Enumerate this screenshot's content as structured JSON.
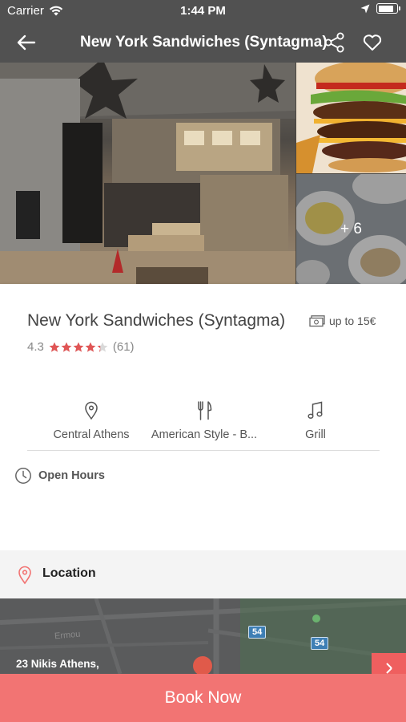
{
  "status_bar": {
    "carrier": "Carrier",
    "time": "1:44 PM",
    "battery_level": 0.9
  },
  "nav": {
    "title": "New York Sandwiches (Syntagma)",
    "icons": [
      "back-arrow-icon",
      "share-icon",
      "heart-icon"
    ]
  },
  "gallery": {
    "more_label": "+ 6"
  },
  "restaurant": {
    "name": "New York Sandwiches (Syntagma)",
    "price_label": "up to 15€",
    "rating_value": "4.3",
    "rating_stars": 4.3,
    "review_count": "(61)"
  },
  "features": [
    {
      "icon": "location-pin-icon",
      "label": "Central Athens"
    },
    {
      "icon": "fork-knife-icon",
      "label": "American Style - B..."
    },
    {
      "icon": "music-note-icon",
      "label": "Grill"
    }
  ],
  "hours": {
    "label": "Open Hours"
  },
  "location": {
    "label": "Location",
    "address": "23 Nikis Athens,",
    "street_label": "Ermou",
    "road_shields": [
      "54",
      "54"
    ]
  },
  "cta": {
    "label": "Book Now"
  },
  "colors": {
    "header": "#515151",
    "accent": "#f27473",
    "star": "#e05555"
  }
}
